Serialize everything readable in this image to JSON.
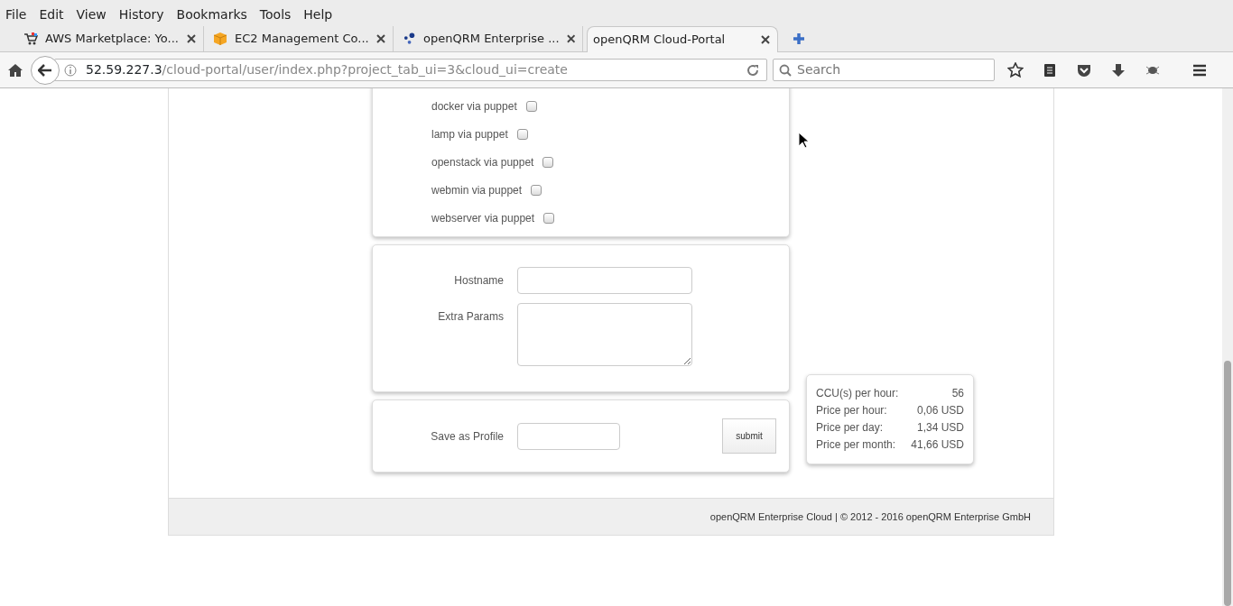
{
  "menu": [
    {
      "label": "File"
    },
    {
      "label": "Edit"
    },
    {
      "label": "View"
    },
    {
      "label": "History"
    },
    {
      "label": "Bookmarks"
    },
    {
      "label": "Tools"
    },
    {
      "label": "Help"
    }
  ],
  "tabs": [
    {
      "label": "AWS Marketplace: Yo...",
      "selected": false
    },
    {
      "label": "EC2 Management Co...",
      "selected": false
    },
    {
      "label": "openQRM Enterprise ...",
      "selected": false
    },
    {
      "label": "openQRM Cloud-Portal",
      "selected": true
    }
  ],
  "address": {
    "host": "52.59.227.3",
    "path": "/cloud-portal/user/index.php?project_tab_ui=3&cloud_ui=create"
  },
  "search": {
    "placeholder": "Search"
  },
  "applications": [
    {
      "label": "docker via puppet",
      "checked": false
    },
    {
      "label": "lamp via puppet",
      "checked": false
    },
    {
      "label": "openstack via puppet",
      "checked": false
    },
    {
      "label": "webmin via puppet",
      "checked": false
    },
    {
      "label": "webserver via puppet",
      "checked": false
    }
  ],
  "host_fields": [
    {
      "label": "Hostname",
      "kind": "input"
    },
    {
      "label": "Extra Params",
      "kind": "textarea"
    }
  ],
  "profile": {
    "label": "Save as Profile",
    "button": "submit"
  },
  "costs": [
    {
      "label": "CCU(s) per hour:",
      "value": "56"
    },
    {
      "label": "Price per hour:",
      "value": "0,06 USD"
    },
    {
      "label": "Price per day:",
      "value": "1,34 USD"
    },
    {
      "label": "Price per month:",
      "value": "41,66 USD"
    }
  ],
  "footer": "openQRM Enterprise Cloud | © 2012 - 2016 openQRM Enterprise GmbH"
}
